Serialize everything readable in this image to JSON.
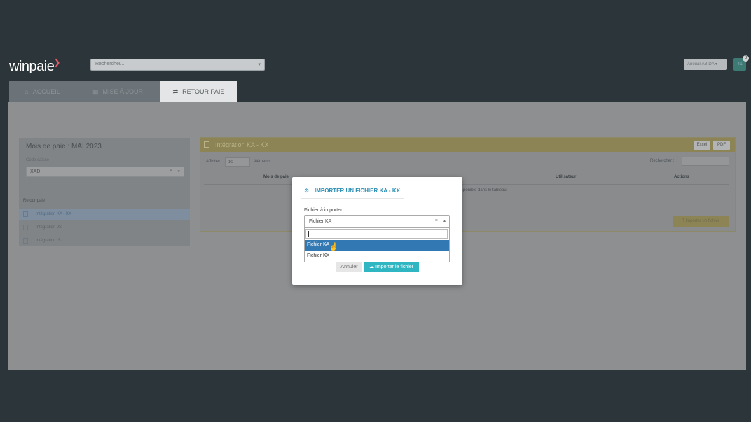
{
  "header": {
    "logo": "winpaie",
    "search_placeholder": "Rechercher...",
    "user_label": "Anouar ABIDA ▾",
    "avatar_label": "41",
    "notification_count": "0"
  },
  "tabs": [
    {
      "label": "ACCUEIL",
      "icon": "home-icon"
    },
    {
      "label": "MISE À JOUR",
      "icon": "calendar-icon"
    },
    {
      "label": "RETOUR PAIE",
      "icon": "exchange-icon"
    }
  ],
  "sidebar": {
    "month_title": "Mois de paie : MAI 2023",
    "code_label": "Code caisse",
    "code_value": "XAD",
    "section_label": "Retour paie",
    "items": [
      {
        "label": "Intégration KA - KX"
      },
      {
        "label": "Intégration JS"
      },
      {
        "label": "Intégration IS"
      }
    ]
  },
  "panel": {
    "title": "Intégration KA - KX",
    "excel_label": "Excel",
    "pdf_label": "PDF",
    "afficher_label": "Afficher",
    "page_size": "10",
    "elements_label": "éléments",
    "search_label": "Rechercher :",
    "columns": [
      "Mois de paie",
      "Utilisateur",
      "Actions"
    ],
    "empty_text": "...ponible dans le tableau",
    "import_button": "Importer un fichier"
  },
  "modal": {
    "title": "IMPORTER UN FICHIER KA - KX",
    "field_label": "Fichier à importer",
    "selected_value": "Fichier KA",
    "options": [
      "Fichier KA",
      "Fichier KX"
    ],
    "cancel_label": "Annuler",
    "submit_label": "Importer le fichier"
  },
  "colors": {
    "accent": "#2fb6c2",
    "selected_option": "#3278b3",
    "modal_title": "#2c8fb4"
  }
}
